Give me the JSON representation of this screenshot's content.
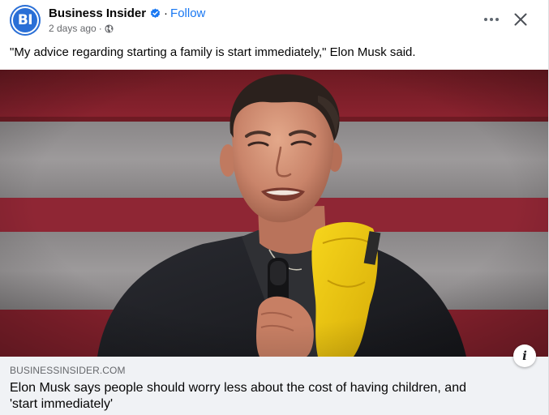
{
  "post": {
    "page_name": "Business Insider",
    "avatar_text": "BI",
    "follow_label": "Follow",
    "separator": "·",
    "timestamp": "2 days ago",
    "audience_icon": "globe-icon",
    "verified_icon": "verified-badge-icon",
    "more_icon": "more-options-icon",
    "close_icon": "close-icon",
    "caption": "\"My advice regarding starting a family is start immediately,\" Elon Musk said."
  },
  "link_preview": {
    "domain": "BUSINESSINSIDER.COM",
    "headline_line1": "Elon Musk says people should worry less about the cost of having children, and",
    "headline_line2": "'start immediately'",
    "info_icon": "info-icon",
    "info_glyph": "i"
  },
  "colors": {
    "brand_blue": "#1877f2",
    "avatar_blue": "#2a6fd6",
    "preview_bg": "#f0f2f5",
    "muted_text": "#65676b",
    "primary_text": "#050505"
  }
}
